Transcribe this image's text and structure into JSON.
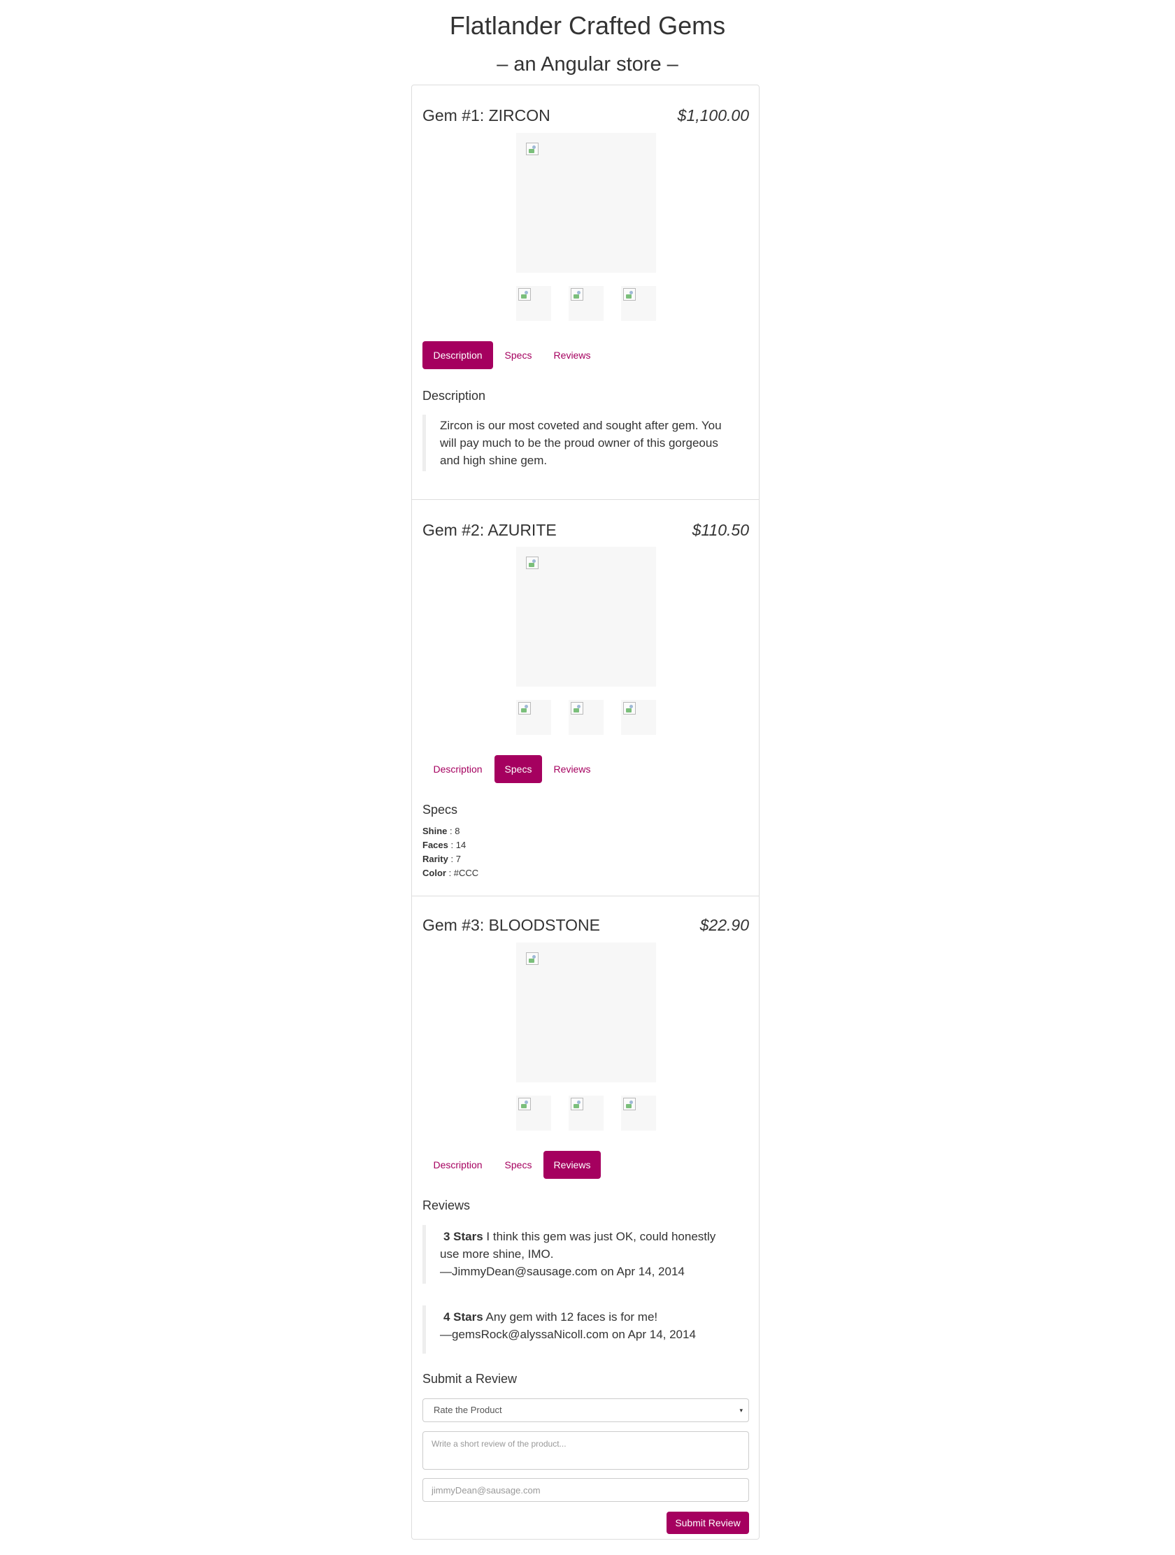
{
  "header": {
    "title": "Flatlander Crafted Gems",
    "subtitle": "– an Angular store –"
  },
  "tabs_labels": [
    "Description",
    "Specs",
    "Reviews"
  ],
  "products": [
    {
      "title": "Gem #1: ZIRCON",
      "price": "$1,100.00",
      "active_tab": "Description",
      "tabs": [
        "Description",
        "Specs",
        "Reviews"
      ],
      "section_heading": "Description",
      "description": "Zircon is our most coveted and sought after gem. You will pay much to be the proud owner of this gorgeous and high shine gem."
    },
    {
      "title": "Gem #2: AZURITE",
      "price": "$110.50",
      "active_tab": "Specs",
      "tabs": [
        "Description",
        "Specs",
        "Reviews"
      ],
      "section_heading": "Specs",
      "specs": [
        {
          "label": "Shine",
          "value": " : 8"
        },
        {
          "label": "Faces",
          "value": " : 14"
        },
        {
          "label": "Rarity",
          "value": " : 7"
        },
        {
          "label": "Color",
          "value": " : #CCC"
        }
      ]
    },
    {
      "title": "Gem #3: BLOODSTONE",
      "price": "$22.90",
      "active_tab": "Reviews",
      "tabs": [
        "Description",
        "Specs",
        "Reviews"
      ],
      "section_heading": "Reviews",
      "reviews": [
        {
          "stars": "3 Stars",
          "body": " I think this gem was just OK, could honestly use more shine, IMO.",
          "byline": "—JimmyDean@sausage.com on Apr 14, 2014"
        },
        {
          "stars": "4 Stars",
          "body": " Any gem with 12 faces is for me!",
          "byline": "—gemsRock@alyssaNicoll.com on Apr 14, 2014"
        }
      ],
      "review_form": {
        "heading": "Submit a Review",
        "rating_placeholder": "Rate the Product",
        "body_placeholder": "Write a short review of the product...",
        "email_placeholder": "jimmyDean@sausage.com",
        "submit_label": "Submit Review"
      }
    }
  ],
  "icons": {
    "broken_image": "broken-image-icon",
    "select_arrow": "▾"
  },
  "colors": {
    "accent": "#a5005f",
    "placeholder_bg": "#f7f7f7",
    "border": "#dddddd"
  }
}
